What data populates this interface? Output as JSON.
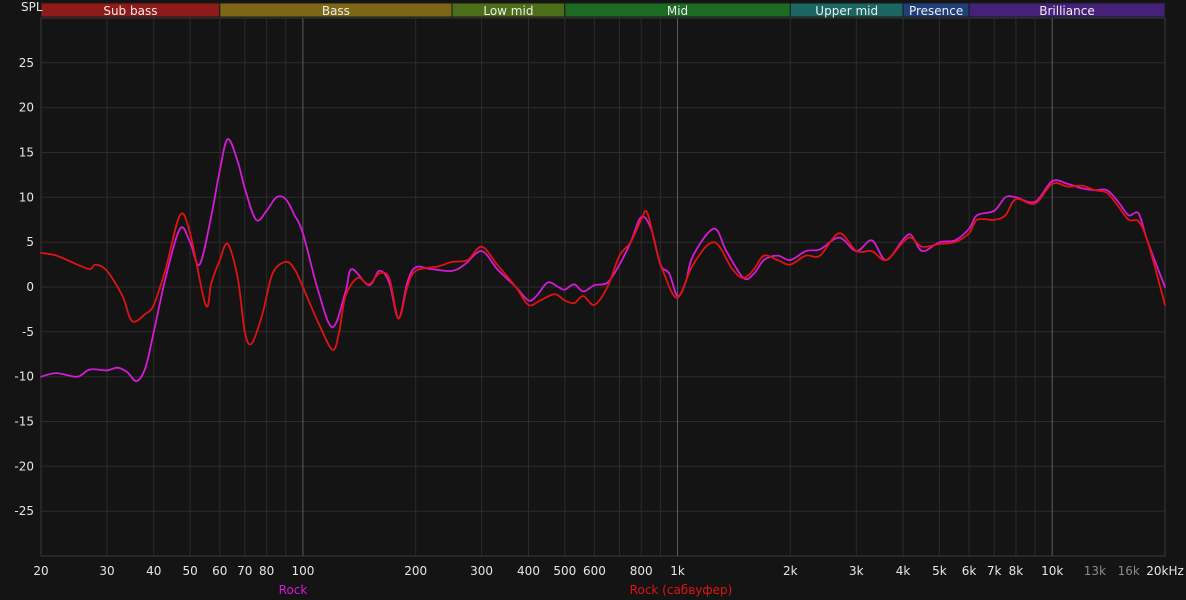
{
  "chart_data": {
    "type": "line",
    "title": "",
    "ylabel": "SPL",
    "xlabel": "",
    "x_scale": "log",
    "xlim": [
      20,
      20000
    ],
    "ylim": [
      -30,
      30
    ],
    "grid": true,
    "bands": [
      {
        "label": "Sub bass",
        "from": 20,
        "to": 60,
        "color": "#8f1a1a"
      },
      {
        "label": "Bass",
        "from": 60,
        "to": 250,
        "color": "#7d6716"
      },
      {
        "label": "Low mid",
        "from": 250,
        "to": 500,
        "color": "#4d6e18"
      },
      {
        "label": "Mid",
        "from": 500,
        "to": 2000,
        "color": "#1b6b23"
      },
      {
        "label": "Upper mid",
        "from": 2000,
        "to": 4000,
        "color": "#1b6663"
      },
      {
        "label": "Presence",
        "from": 4000,
        "to": 6000,
        "color": "#203e78"
      },
      {
        "label": "Brilliance",
        "from": 6000,
        "to": 20000,
        "color": "#46217a"
      }
    ],
    "x_ticks": [
      {
        "value": 20,
        "label": "20"
      },
      {
        "value": 30,
        "label": "30"
      },
      {
        "value": 40,
        "label": "40"
      },
      {
        "value": 50,
        "label": "50"
      },
      {
        "value": 60,
        "label": "60"
      },
      {
        "value": 70,
        "label": "70"
      },
      {
        "value": 80,
        "label": "80"
      },
      {
        "value": 100,
        "label": "100"
      },
      {
        "value": 200,
        "label": "200"
      },
      {
        "value": 300,
        "label": "300"
      },
      {
        "value": 400,
        "label": "400"
      },
      {
        "value": 500,
        "label": "500"
      },
      {
        "value": 600,
        "label": "600"
      },
      {
        "value": 800,
        "label": "800"
      },
      {
        "value": 1000,
        "label": "1k"
      },
      {
        "value": 2000,
        "label": "2k"
      },
      {
        "value": 3000,
        "label": "3k"
      },
      {
        "value": 4000,
        "label": "4k"
      },
      {
        "value": 5000,
        "label": "5k"
      },
      {
        "value": 6000,
        "label": "6k"
      },
      {
        "value": 7000,
        "label": "7k"
      },
      {
        "value": 8000,
        "label": "8k"
      },
      {
        "value": 10000,
        "label": "10k"
      },
      {
        "value": 13000,
        "label": "13k",
        "dim": true
      },
      {
        "value": 16000,
        "label": "16k",
        "dim": true
      },
      {
        "value": 20000,
        "label": "20kHz"
      }
    ],
    "y_ticks": [
      25,
      20,
      15,
      10,
      5,
      0,
      -5,
      -10,
      -15,
      -20,
      -25
    ],
    "colors": {
      "background": "#141414",
      "grid": "#2b2b2b",
      "major_grid": "#5a5a5a"
    },
    "series": [
      {
        "name": "Rock",
        "color": "#d41ad4",
        "points": [
          [
            20,
            -10
          ],
          [
            22,
            -9.6
          ],
          [
            25,
            -10
          ],
          [
            27,
            -9.2
          ],
          [
            30,
            -9.3
          ],
          [
            32,
            -9
          ],
          [
            34,
            -9.5
          ],
          [
            36,
            -10.5
          ],
          [
            38,
            -9
          ],
          [
            40,
            -5
          ],
          [
            43,
            1
          ],
          [
            47,
            6.5
          ],
          [
            50,
            5
          ],
          [
            53,
            2.5
          ],
          [
            57,
            8
          ],
          [
            60,
            13
          ],
          [
            63,
            16.5
          ],
          [
            67,
            14
          ],
          [
            70,
            11
          ],
          [
            75,
            7.5
          ],
          [
            80,
            8.5
          ],
          [
            85,
            10
          ],
          [
            90,
            9.8
          ],
          [
            95,
            8
          ],
          [
            100,
            6
          ],
          [
            110,
            -0.5
          ],
          [
            120,
            -4.5
          ],
          [
            130,
            -0.5
          ],
          [
            135,
            2
          ],
          [
            150,
            0.2
          ],
          [
            160,
            1.8
          ],
          [
            170,
            0.5
          ],
          [
            180,
            -3.5
          ],
          [
            190,
            0.5
          ],
          [
            200,
            2.2
          ],
          [
            220,
            2
          ],
          [
            250,
            1.8
          ],
          [
            270,
            2.5
          ],
          [
            300,
            4
          ],
          [
            330,
            2
          ],
          [
            370,
            0
          ],
          [
            400,
            -1.5
          ],
          [
            420,
            -1
          ],
          [
            450,
            0.5
          ],
          [
            480,
            0
          ],
          [
            500,
            -0.3
          ],
          [
            530,
            0.3
          ],
          [
            560,
            -0.5
          ],
          [
            600,
            0.2
          ],
          [
            650,
            0.5
          ],
          [
            700,
            2.5
          ],
          [
            750,
            5
          ],
          [
            800,
            7.8
          ],
          [
            850,
            6.5
          ],
          [
            900,
            2.5
          ],
          [
            950,
            1.5
          ],
          [
            1000,
            -1
          ],
          [
            1050,
            0.5
          ],
          [
            1100,
            3.5
          ],
          [
            1250,
            6.5
          ],
          [
            1350,
            4
          ],
          [
            1500,
            1
          ],
          [
            1600,
            1.5
          ],
          [
            1700,
            3
          ],
          [
            1850,
            3.5
          ],
          [
            2000,
            3
          ],
          [
            2200,
            4
          ],
          [
            2400,
            4.2
          ],
          [
            2700,
            5.5
          ],
          [
            3000,
            4
          ],
          [
            3300,
            5.2
          ],
          [
            3600,
            3
          ],
          [
            4000,
            5.3
          ],
          [
            4200,
            5.8
          ],
          [
            4500,
            4
          ],
          [
            5000,
            5
          ],
          [
            5500,
            5.2
          ],
          [
            6000,
            6.5
          ],
          [
            6300,
            8
          ],
          [
            7000,
            8.5
          ],
          [
            7500,
            10
          ],
          [
            8000,
            10
          ],
          [
            9000,
            9.5
          ],
          [
            10000,
            11.8
          ],
          [
            11000,
            11.5
          ],
          [
            12000,
            11
          ],
          [
            13000,
            10.8
          ],
          [
            14000,
            10.8
          ],
          [
            15000,
            9.5
          ],
          [
            16000,
            8
          ],
          [
            17000,
            8.2
          ],
          [
            18000,
            5
          ],
          [
            20000,
            0
          ]
        ]
      },
      {
        "name": "Rock (сабвуфер)",
        "color": "#e01212",
        "points": [
          [
            20,
            3.8
          ],
          [
            22,
            3.5
          ],
          [
            25,
            2.5
          ],
          [
            27,
            2
          ],
          [
            28,
            2.5
          ],
          [
            30,
            1.8
          ],
          [
            33,
            -1
          ],
          [
            35,
            -3.8
          ],
          [
            38,
            -3
          ],
          [
            40,
            -2
          ],
          [
            43,
            2
          ],
          [
            47,
            8
          ],
          [
            50,
            6
          ],
          [
            55,
            -2
          ],
          [
            57,
            0.5
          ],
          [
            60,
            3
          ],
          [
            63,
            4.8
          ],
          [
            67,
            1
          ],
          [
            70,
            -5
          ],
          [
            73,
            -6.3
          ],
          [
            78,
            -3
          ],
          [
            83,
            1.5
          ],
          [
            90,
            2.8
          ],
          [
            95,
            2
          ],
          [
            100,
            0
          ],
          [
            110,
            -4
          ],
          [
            120,
            -7
          ],
          [
            125,
            -5
          ],
          [
            130,
            -1
          ],
          [
            140,
            1
          ],
          [
            150,
            0.3
          ],
          [
            160,
            1.5
          ],
          [
            170,
            1
          ],
          [
            180,
            -3.5
          ],
          [
            190,
            0
          ],
          [
            200,
            1.8
          ],
          [
            230,
            2.3
          ],
          [
            250,
            2.8
          ],
          [
            275,
            3
          ],
          [
            300,
            4.5
          ],
          [
            330,
            2.5
          ],
          [
            370,
            0
          ],
          [
            400,
            -2
          ],
          [
            430,
            -1.5
          ],
          [
            470,
            -0.8
          ],
          [
            500,
            -1.5
          ],
          [
            530,
            -1.8
          ],
          [
            560,
            -1
          ],
          [
            600,
            -2
          ],
          [
            650,
            0
          ],
          [
            700,
            3.5
          ],
          [
            750,
            5
          ],
          [
            800,
            7.5
          ],
          [
            830,
            8.3
          ],
          [
            880,
            4
          ],
          [
            920,
            1.5
          ],
          [
            1000,
            -1.2
          ],
          [
            1100,
            2.5
          ],
          [
            1250,
            5
          ],
          [
            1400,
            2
          ],
          [
            1500,
            1
          ],
          [
            1600,
            2
          ],
          [
            1700,
            3.5
          ],
          [
            1850,
            3
          ],
          [
            2000,
            2.5
          ],
          [
            2200,
            3.5
          ],
          [
            2400,
            3.5
          ],
          [
            2700,
            6
          ],
          [
            3000,
            4
          ],
          [
            3300,
            4
          ],
          [
            3600,
            3
          ],
          [
            4000,
            5
          ],
          [
            4200,
            5.5
          ],
          [
            4500,
            4.5
          ],
          [
            5000,
            4.8
          ],
          [
            5500,
            5
          ],
          [
            6000,
            6
          ],
          [
            6300,
            7.5
          ],
          [
            7000,
            7.5
          ],
          [
            7500,
            8
          ],
          [
            8000,
            9.8
          ],
          [
            9000,
            9.3
          ],
          [
            10000,
            11.5
          ],
          [
            11000,
            11.2
          ],
          [
            12000,
            11.3
          ],
          [
            13000,
            10.8
          ],
          [
            14000,
            10.5
          ],
          [
            15000,
            9
          ],
          [
            16000,
            7.5
          ],
          [
            17000,
            7.3
          ],
          [
            18000,
            5
          ],
          [
            20000,
            -2
          ]
        ]
      }
    ]
  }
}
